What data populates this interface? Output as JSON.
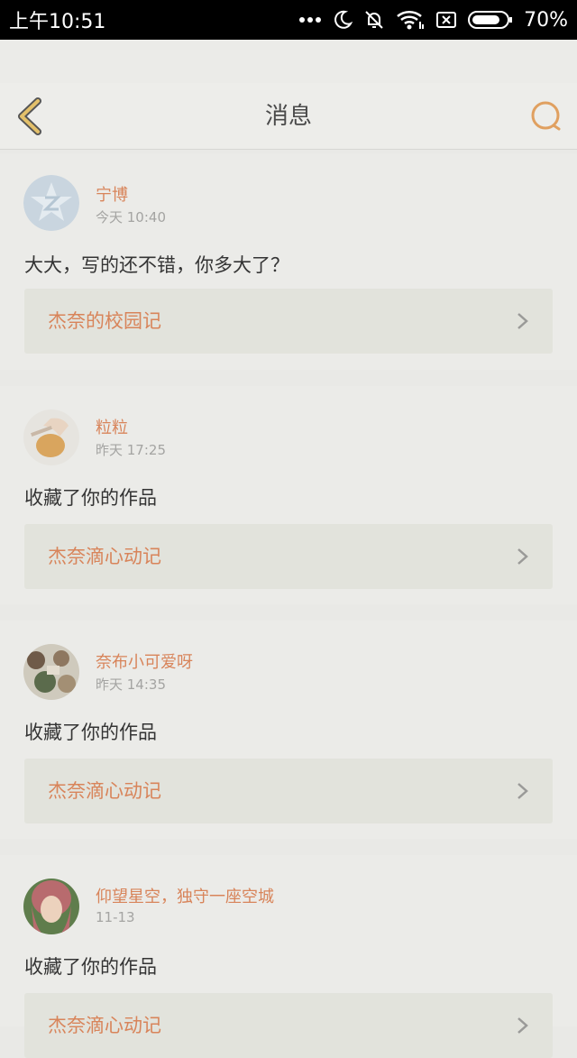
{
  "status_bar": {
    "time": "上午10:51",
    "battery_percent": "70%",
    "icons": [
      "more-dots-icon",
      "moon-icon",
      "bell-muted-icon",
      "wifi-icon",
      "no-sim-icon",
      "battery-icon"
    ]
  },
  "header": {
    "title": "消息",
    "back_icon": "chevron-left-icon",
    "search_icon": "search-icon",
    "accent_color": "#e0a060"
  },
  "messages": [
    {
      "name": "宁博",
      "time": "今天 10:40",
      "text": "大大，写的还不错，你多大了？",
      "work": "杰奈的校园记",
      "avatar": "default-q-avatar"
    },
    {
      "name": "粒粒",
      "time": "昨天 17:25",
      "text": "收藏了你的作品",
      "work": "杰奈滴心动记",
      "avatar": "photo-avatar"
    },
    {
      "name": "奈布小可爱呀",
      "time": "昨天 14:35",
      "text": "收藏了你的作品",
      "work": "杰奈滴心动记",
      "avatar": "photo-avatar"
    },
    {
      "name": "仰望星空，独守一座空城",
      "time": "11-13",
      "text": "收藏了你的作品",
      "work": "杰奈滴心动记",
      "avatar": "photo-avatar"
    }
  ],
  "colors": {
    "name": "#d8845a",
    "work_title": "#d8845a",
    "text": "#343434",
    "meta": "#a4a4a2"
  }
}
